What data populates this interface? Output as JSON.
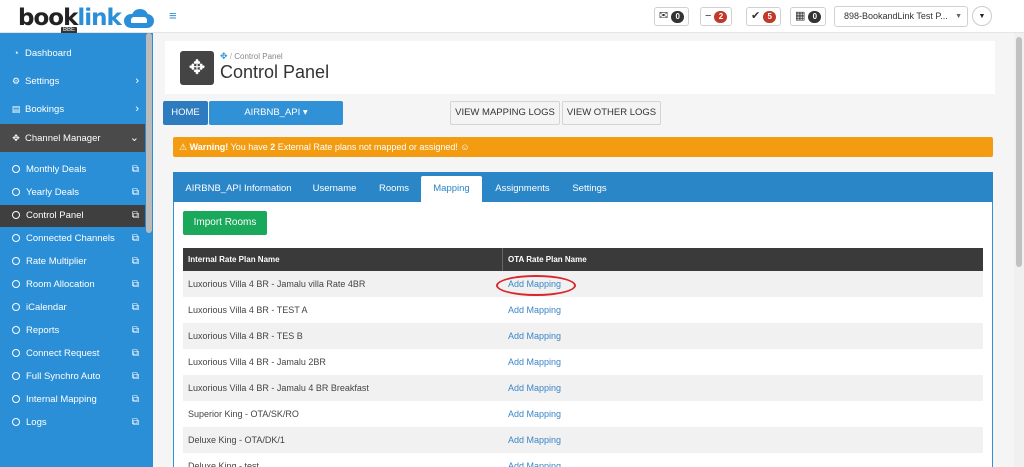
{
  "brand": {
    "name_part1": "book",
    "name_part2": "link",
    "tag": "BBE"
  },
  "topbar": {
    "notifications": [
      {
        "icon": "envelope-icon",
        "glyph": "✉",
        "count": "0",
        "color": "#333333"
      },
      {
        "icon": "minus-icon",
        "glyph": "−",
        "count": "2",
        "color": "#c0392b"
      },
      {
        "icon": "check-icon",
        "glyph": "✔",
        "count": "5",
        "color": "#c0392b"
      },
      {
        "icon": "calendar-icon",
        "glyph": "▦",
        "count": "0",
        "color": "#333333"
      }
    ],
    "hotel_select": "898-BookandLink Test P...",
    "user_caret": "▼"
  },
  "sidebar": {
    "items": [
      {
        "label": "Dashboard",
        "icon": "dashboard-icon",
        "glyph": "◔"
      },
      {
        "label": "Settings",
        "icon": "gear-icon",
        "glyph": "⚙",
        "chevron": "›"
      },
      {
        "label": "Bookings",
        "icon": "bookings-icon",
        "glyph": "▤",
        "chevron": "›"
      },
      {
        "label": "Channel Manager",
        "icon": "move-icon",
        "glyph": "✥",
        "chevron": "⌄"
      }
    ],
    "subitems": [
      "Monthly Deals",
      "Yearly Deals",
      "Control Panel",
      "Connected Channels",
      "Rate Multiplier",
      "Room Allocation",
      "iCalendar",
      "Reports",
      "Connect Request",
      "Full Synchro Auto",
      "Internal Mapping",
      "Logs"
    ]
  },
  "header": {
    "breadcrumb": "Control Panel",
    "title": "Control Panel"
  },
  "actions": {
    "home": "HOME",
    "channel": "AIRBNB_API ▾",
    "view_mapping_logs": "VIEW MAPPING LOGS",
    "view_other_logs": "VIEW OTHER LOGS"
  },
  "warning": {
    "strong": "⚠ Warning!",
    "text_before": " You have ",
    "count": "2",
    "text_after": " External Rate plans not mapped or assigned! ☺"
  },
  "tabs": [
    "AIRBNB_API Information",
    "Username",
    "Rooms",
    "Mapping",
    "Assignments",
    "Settings"
  ],
  "active_tab": "Mapping",
  "import_button": "Import Rooms",
  "table": {
    "columns": [
      "Internal Rate Plan Name",
      "OTA Rate Plan Name"
    ],
    "rows": [
      {
        "name": "Luxorious Villa 4 BR - Jamalu villa Rate 4BR",
        "link": "Add Mapping"
      },
      {
        "name": "Luxorious Villa 4 BR - TEST A",
        "link": "Add Mapping"
      },
      {
        "name": "Luxorious Villa 4 BR - TES B",
        "link": "Add Mapping"
      },
      {
        "name": "Luxorious Villa 4 BR - Jamalu 2BR",
        "link": "Add Mapping"
      },
      {
        "name": "Luxorious Villa 4 BR - Jamalu 4 BR Breakfast",
        "link": "Add Mapping"
      },
      {
        "name": "Superior King - OTA/SK/RO",
        "link": "Add Mapping"
      },
      {
        "name": "Deluxe King - OTA/DK/1",
        "link": "Add Mapping"
      },
      {
        "name": "Deluxe King - test",
        "link": "Add Mapping"
      }
    ]
  }
}
